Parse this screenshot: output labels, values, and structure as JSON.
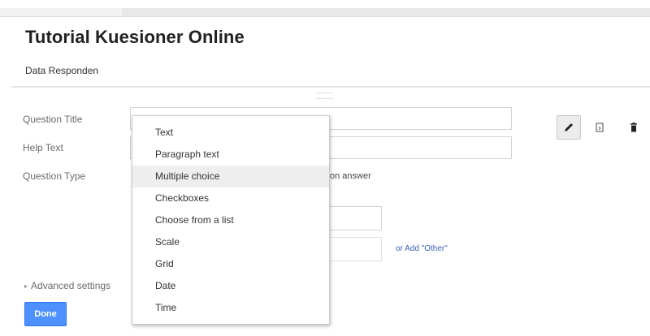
{
  "form": {
    "title": "Tutorial Kuesioner Online",
    "section_title": "Data Responden"
  },
  "question": {
    "title_label": "Question Title",
    "help_label": "Help Text",
    "type_label": "Question Type",
    "type_hint_partial": "on answer",
    "add_other_link": "or Add \"Other\"",
    "advanced_settings": "Advanced settings",
    "done_button": "Done"
  },
  "dropdown": {
    "items": [
      "Text",
      "Paragraph text",
      "Multiple choice",
      "Checkboxes",
      "Choose from a list",
      "Scale",
      "Grid",
      "Date",
      "Time"
    ],
    "highlighted": "Multiple choice"
  },
  "toolbar": {
    "icons": [
      "pencil-icon",
      "duplicate-icon",
      "trash-icon"
    ]
  },
  "colors": {
    "done_button": "#4d90fe",
    "link": "#3a5fb8",
    "highlight": "#eeeeee"
  }
}
